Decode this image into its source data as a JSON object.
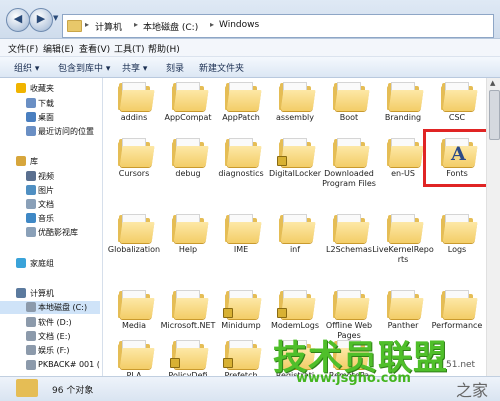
{
  "address": {
    "crumbs": [
      "计算机",
      "本地磁盘 (C:)",
      "Windows"
    ]
  },
  "menu": [
    "文件(F)",
    "编辑(E)",
    "查看(V)",
    "工具(T)",
    "帮助(H)"
  ],
  "toolbar": [
    "组织 ▾",
    "包含到库中 ▾",
    "共享 ▾",
    "刻录",
    "新建文件夹"
  ],
  "sidebar": {
    "items": [
      {
        "label": "收藏夹",
        "icon": "star-icon",
        "color": "#f0b400"
      },
      {
        "label": "下载",
        "icon": "download-icon",
        "color": "#6a8fc4"
      },
      {
        "label": "桌面",
        "icon": "desktop-icon",
        "color": "#4a7fc0"
      },
      {
        "label": "最近访问的位置",
        "icon": "recent-icon",
        "color": "#6a8fc4"
      },
      {
        "label": "库",
        "icon": "library-icon",
        "color": "#d7a63c"
      },
      {
        "label": "视频",
        "icon": "video-icon",
        "color": "#5a6f8f"
      },
      {
        "label": "图片",
        "icon": "pictures-icon",
        "color": "#4f8fc2"
      },
      {
        "label": "文档",
        "icon": "documents-icon",
        "color": "#8aa0b8"
      },
      {
        "label": "音乐",
        "icon": "music-icon",
        "color": "#3f88c5"
      },
      {
        "label": "优酷影视库",
        "icon": "youku-icon",
        "color": "#8aa0b8"
      },
      {
        "label": "家庭组",
        "icon": "homegroup-icon",
        "color": "#3aa3d9"
      },
      {
        "label": "计算机",
        "icon": "computer-icon",
        "color": "#5b7a9e"
      },
      {
        "label": "本地磁盘 (C:)",
        "icon": "drive-icon",
        "color": "#8c9aab"
      },
      {
        "label": "软件 (D:)",
        "icon": "drive-icon",
        "color": "#8c9aab"
      },
      {
        "label": "文档 (E:)",
        "icon": "drive-icon",
        "color": "#8c9aab"
      },
      {
        "label": "娱乐 (F:)",
        "icon": "drive-icon",
        "color": "#8c9aab"
      },
      {
        "label": "PKBACK# 001 (",
        "icon": "drive-icon",
        "color": "#8c9aab"
      }
    ]
  },
  "folders": [
    [
      "addins",
      "AppCompat",
      "AppPatch",
      "assembly",
      "Boot",
      "Branding",
      "CSC"
    ],
    [
      "Cursors",
      "debug",
      "diagnostics",
      "DigitalLocker",
      "Downloaded Program Files",
      "en-US",
      "Fonts"
    ],
    [
      "Globalization",
      "Help",
      "IME",
      "inf",
      "L2Schemas",
      "LiveKernelReports",
      "Logs"
    ],
    [
      "Media",
      "Microsoft.NET",
      "Minidump",
      "ModemLogs",
      "Offline Web Pages",
      "Panther",
      "Performance"
    ],
    [
      "PLA",
      "PolicyDefi",
      "Prefetch",
      "Registrati",
      "RemotePa",
      "",
      ""
    ]
  ],
  "status": {
    "count": "96 个对象"
  },
  "watermark": {
    "brand": "技术员联盟",
    "url": "www.jsgho.com",
    "partial_url": "51.net",
    "tail": "之家"
  },
  "colors": {
    "highlight": "#e02424",
    "watermark": "#4fbf2a"
  }
}
